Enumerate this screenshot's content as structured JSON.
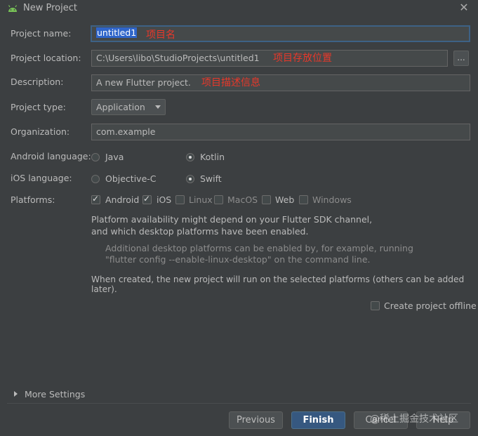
{
  "window": {
    "title": "New Project",
    "close_glyph": "✕"
  },
  "form": {
    "project_name": {
      "label": "Project name:",
      "value": "untitled1",
      "annotation": "项目名"
    },
    "project_location": {
      "label": "Project location:",
      "value": "C:\\Users\\libo\\StudioProjects\\untitled1",
      "annotation": "项目存放位置",
      "browse_label": "..."
    },
    "description": {
      "label": "Description:",
      "value": "A new Flutter project.",
      "annotation": "项目描述信息"
    },
    "project_type": {
      "label": "Project type:",
      "value": "Application"
    },
    "organization": {
      "label": "Organization:",
      "value": "com.example"
    },
    "android_language": {
      "label": "Android language:",
      "options": [
        "Java",
        "Kotlin"
      ],
      "selected": "Kotlin"
    },
    "ios_language": {
      "label": "iOS language:",
      "options": [
        "Objective-C",
        "Swift"
      ],
      "selected": "Swift"
    },
    "platforms": {
      "label": "Platforms:",
      "items": [
        {
          "name": "Android",
          "checked": true
        },
        {
          "name": "iOS",
          "checked": true
        },
        {
          "name": "Linux",
          "checked": false
        },
        {
          "name": "MacOS",
          "checked": false
        },
        {
          "name": "Web",
          "checked": false
        },
        {
          "name": "Windows",
          "checked": false
        }
      ]
    },
    "info_line1": "Platform availability might depend on your Flutter SDK channel,",
    "info_line2": "and which desktop platforms have been enabled.",
    "hint_line1": "Additional desktop platforms can be enabled by, for example, running",
    "hint_line2": "\"flutter config --enable-linux-desktop\" on the command line.",
    "created_note": "When created, the new project will run on the selected platforms (others can be added later).",
    "offline": {
      "label": "Create project offline",
      "checked": false
    }
  },
  "more_settings": {
    "label": "More Settings"
  },
  "buttons": {
    "previous": "Previous",
    "finish": "Finish",
    "cancel": "Cancel",
    "help": "Help"
  },
  "watermark": "@稀土掘金技术社区",
  "colors": {
    "background": "#3c3f41",
    "field": "#45494a",
    "primary": "#365880",
    "annotation": "#e8382a"
  }
}
